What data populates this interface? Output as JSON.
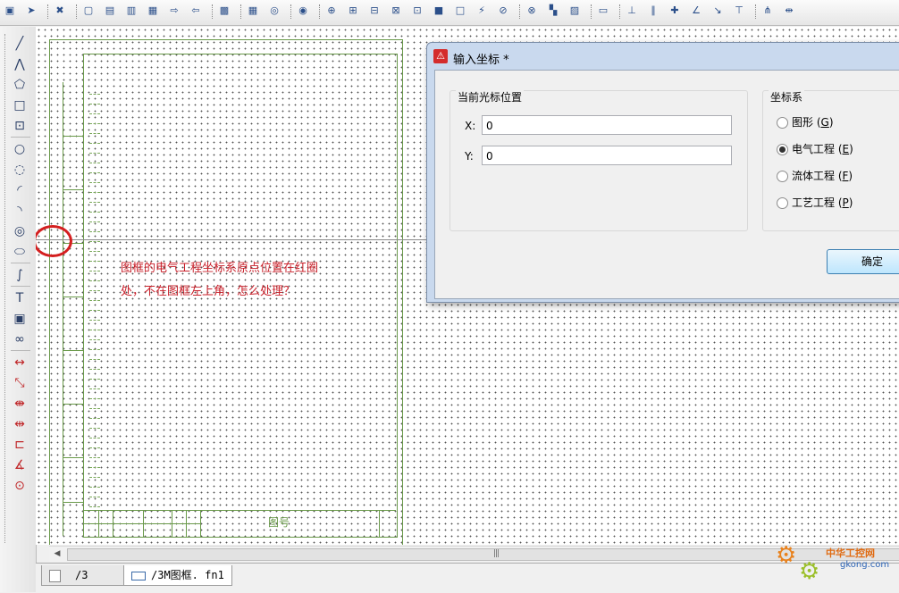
{
  "toolbar": {
    "icons": [
      "save-icon",
      "run-icon",
      "delete-icon",
      "page-icon",
      "new-page-icon",
      "page-edit-icon",
      "page-rename-icon",
      "page-export-icon",
      "page-import-icon",
      "grid-icon",
      "snap-icon",
      "macro-icon",
      "insert-macro-icon",
      "device-icon",
      "terminal-icon",
      "plug-icon",
      "cable-icon",
      "connection-icon",
      "black-box-icon",
      "structure-box-icon",
      "potential-icon",
      "interrupt-icon",
      "connector-icon",
      "fill-icon",
      "hatch-icon",
      "window-icon",
      "measure-icon",
      "line-icon",
      "cross-icon",
      "angle-icon",
      "path-icon",
      "t-node-icon",
      "connect-icon",
      "symbol-icon"
    ]
  },
  "left_toolbar": {
    "icons": [
      "line-icon",
      "polyline-icon",
      "polygon-icon",
      "rectangle-icon",
      "text-box-icon",
      "circle-icon",
      "circle-3pt-icon",
      "arc-icon",
      "arc-center-icon",
      "ring-icon",
      "ellipse-icon",
      "spline-icon",
      "text-icon",
      "image-icon",
      "link-icon",
      "dim-linear-icon",
      "dim-aligned-icon",
      "dim-chain-icon",
      "dim-increment-icon",
      "dim-base-icon",
      "dim-angle-icon",
      "dim-radius-icon"
    ],
    "text_glyph": "T"
  },
  "canvas": {
    "title_block_text": "图号",
    "annotation": "图框的电气工程坐标系原点位置在红圈处，不在图框左上角，怎么处理？"
  },
  "dialog": {
    "title": "输入坐标 *",
    "position_group": "当前光标位置",
    "x_label": "X:",
    "x_value": "0",
    "y_label": "Y:",
    "y_value": "0",
    "coord_group": "坐标系",
    "options": [
      {
        "label": "图形",
        "key": "G",
        "selected": false
      },
      {
        "label": "电气工程",
        "key": "E",
        "selected": true
      },
      {
        "label": "流体工程",
        "key": "F",
        "selected": false
      },
      {
        "label": "工艺工程",
        "key": "P",
        "selected": false
      }
    ],
    "ok_label": "确定"
  },
  "tabs": [
    {
      "label": "/3",
      "active": false
    },
    {
      "label": "/3M图框. fn1",
      "active": true
    }
  ],
  "watermark": {
    "line1": "中华工控网",
    "line2": "gkong.com"
  },
  "colors": {
    "frame": "#6a9a4a",
    "annotation": "#c8202a",
    "dialog_frame": "#c9d9ee"
  }
}
